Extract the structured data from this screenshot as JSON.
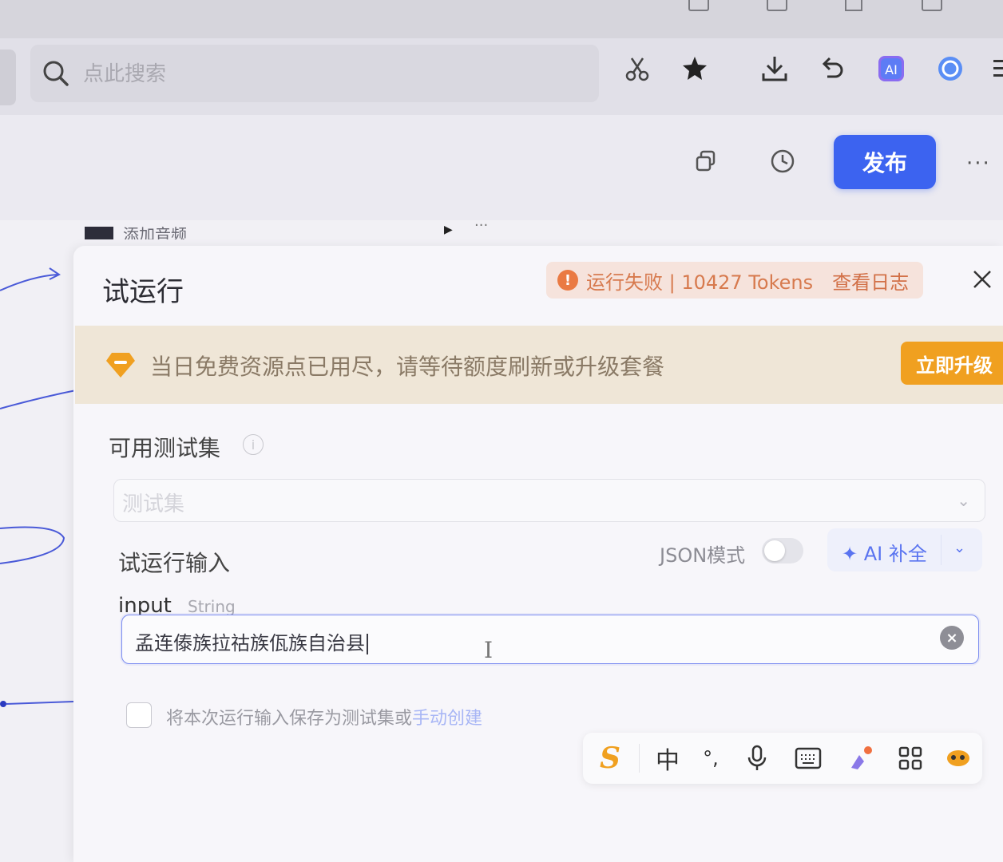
{
  "browser": {
    "search_placeholder": "点此搜索"
  },
  "header": {
    "publish_label": "发布",
    "more_label": "···"
  },
  "canvas": {
    "node_label": "添加音频"
  },
  "panel": {
    "title": "试运行",
    "status": {
      "text": "运行失败 | 10427 Tokens",
      "log_link": "查看日志",
      "color": "#ea7a43"
    },
    "banner": {
      "text": "当日免费资源点已用尽，请等待额度刷新或升级套餐",
      "upgrade_label": "立即升级",
      "accent": "#f0a020"
    },
    "testset": {
      "label": "可用测试集",
      "placeholder": "测试集"
    },
    "run_input": {
      "label": "试运行输入",
      "json_mode_label": "JSON模式",
      "json_mode_on": false,
      "ai_complete_label": "AI 补全"
    },
    "field": {
      "name": "input",
      "type": "String",
      "value": "孟连傣族拉祜族佤族自治县"
    },
    "save": {
      "text": "将本次运行输入保存为测试集或",
      "link": "手动创建",
      "checked": false
    }
  },
  "ime": {
    "logo": "S",
    "lang": "中",
    "punct": "°,",
    "icons": [
      "sogou-logo-icon",
      "chinese-mode-icon",
      "punctuation-icon",
      "microphone-icon",
      "keyboard-icon",
      "skin-icon",
      "grid-apps-icon",
      "toolbox-icon"
    ]
  },
  "colors": {
    "primary": "#3c63f0",
    "error": "#ea7a43",
    "warning": "#f0a020"
  }
}
